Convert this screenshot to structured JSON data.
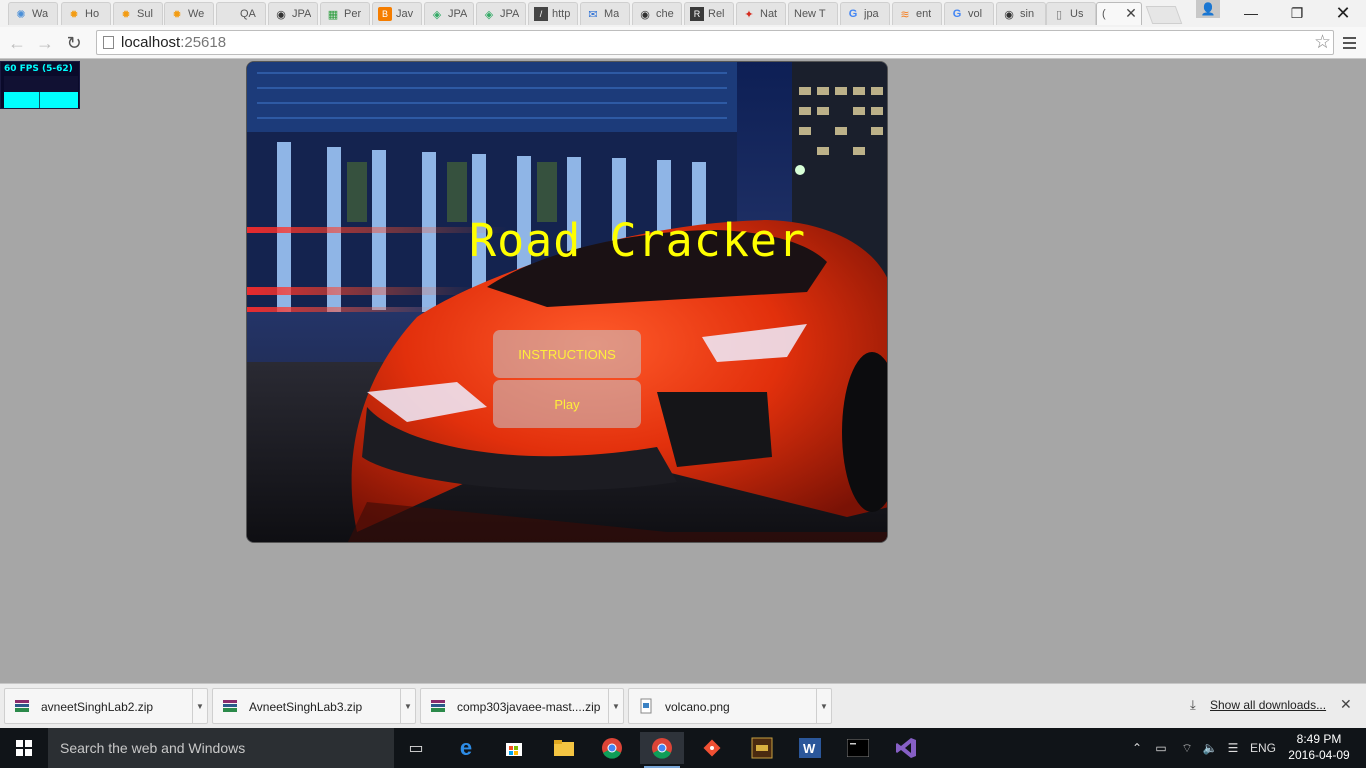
{
  "browser": {
    "tabs": [
      {
        "title": "Wa",
        "icon": "bulb-icon"
      },
      {
        "title": "Ho",
        "icon": "sun-icon"
      },
      {
        "title": "Sul",
        "icon": "sun-icon"
      },
      {
        "title": "We",
        "icon": "sun-icon"
      },
      {
        "title": "QA",
        "icon": "blank-icon"
      },
      {
        "title": "JPA",
        "icon": "github-icon"
      },
      {
        "title": "Per",
        "icon": "sheet-icon"
      },
      {
        "title": "Jav",
        "icon": "blogger-icon"
      },
      {
        "title": "JPA",
        "icon": "diamond-icon"
      },
      {
        "title": "JPA",
        "icon": "diamond-icon"
      },
      {
        "title": "http",
        "icon": "bracket-icon"
      },
      {
        "title": "Ma",
        "icon": "mail-icon"
      },
      {
        "title": "che",
        "icon": "github-icon"
      },
      {
        "title": "Rel",
        "icon": "rel-icon"
      },
      {
        "title": "Nat",
        "icon": "maple-icon"
      },
      {
        "title": "New T",
        "icon": "blank-icon"
      },
      {
        "title": "jpa",
        "icon": "google-icon"
      },
      {
        "title": "ent",
        "icon": "stack-icon"
      },
      {
        "title": "vol",
        "icon": "google-icon"
      },
      {
        "title": "sin",
        "icon": "github-icon"
      },
      {
        "title": "Us",
        "icon": "page-icon"
      },
      {
        "title": "(",
        "icon": "blank-icon"
      }
    ],
    "url_host": "localhost",
    "url_port": ":25618"
  },
  "fps_meter": {
    "label": "60 FPS (5-62)"
  },
  "game": {
    "title": "Road Cracker",
    "instructions_label": "INSTRUCTIONS",
    "play_label": "Play"
  },
  "downloads": {
    "items": [
      {
        "name": "avneetSinghLab2.zip",
        "icon": "archive-icon"
      },
      {
        "name": "AvneetSinghLab3.zip",
        "icon": "archive-icon"
      },
      {
        "name": "comp303javaee-mast....zip",
        "icon": "archive-icon"
      },
      {
        "name": "volcano.png",
        "icon": "image-file-icon"
      }
    ],
    "show_all": "Show all downloads..."
  },
  "taskbar": {
    "search_placeholder": "Search the web and Windows",
    "language": "ENG",
    "time": "8:49 PM",
    "date": "2016-04-09"
  }
}
